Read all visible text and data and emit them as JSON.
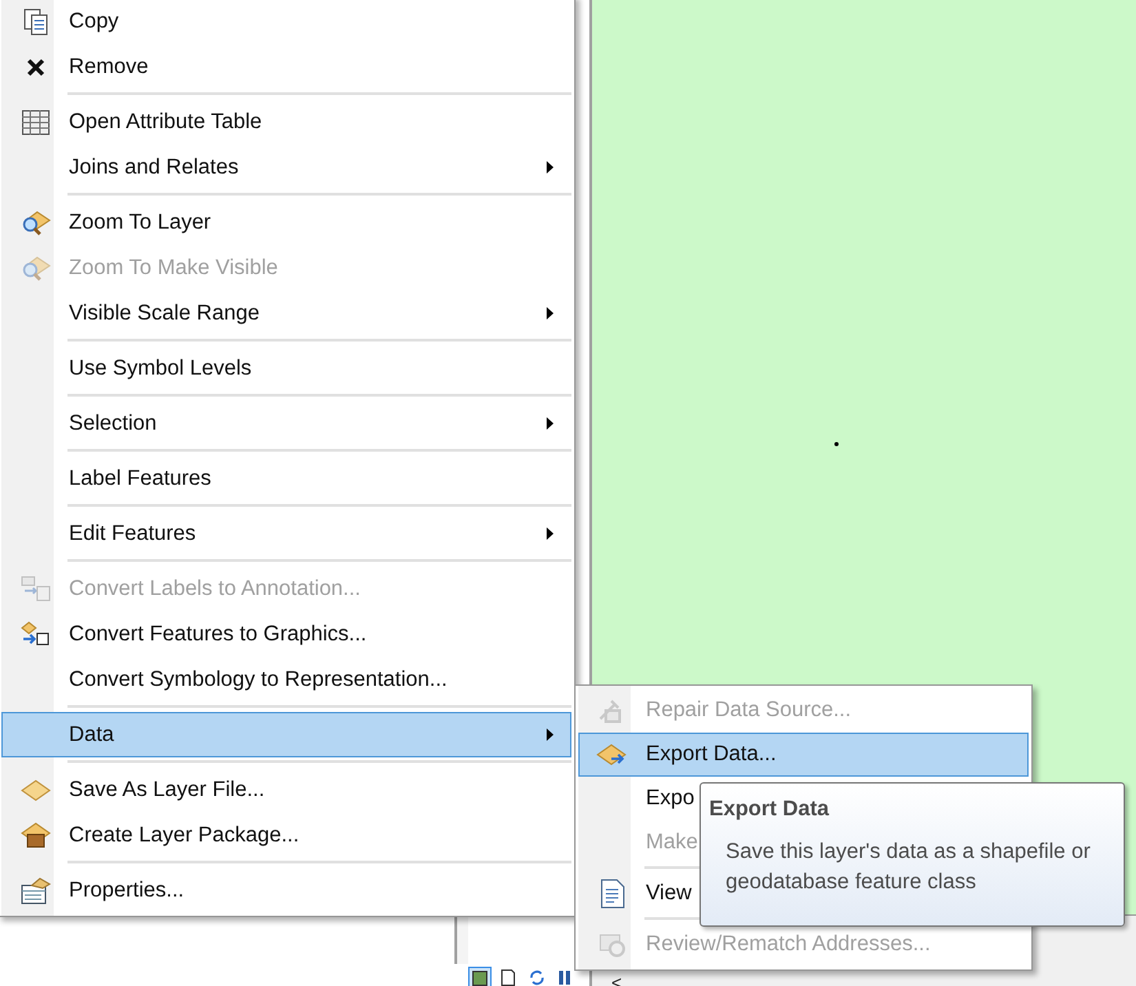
{
  "context_menu": {
    "items": [
      {
        "kind": "item",
        "label": "Copy",
        "disabled": false,
        "selected": false,
        "submenu": false
      },
      {
        "kind": "item",
        "label": "Remove",
        "disabled": false,
        "selected": false,
        "submenu": false
      },
      {
        "kind": "separator"
      },
      {
        "kind": "item",
        "label": "Open Attribute Table",
        "disabled": false,
        "selected": false,
        "submenu": false
      },
      {
        "kind": "item",
        "label": "Joins and Relates",
        "disabled": false,
        "selected": false,
        "submenu": true
      },
      {
        "kind": "separator"
      },
      {
        "kind": "item",
        "label": "Zoom To Layer",
        "disabled": false,
        "selected": false,
        "submenu": false
      },
      {
        "kind": "item",
        "label": "Zoom To Make Visible",
        "disabled": true,
        "selected": false,
        "submenu": false
      },
      {
        "kind": "item",
        "label": "Visible Scale Range",
        "disabled": false,
        "selected": false,
        "submenu": true
      },
      {
        "kind": "separator"
      },
      {
        "kind": "item",
        "label": "Use Symbol Levels",
        "disabled": false,
        "selected": false,
        "submenu": false
      },
      {
        "kind": "separator"
      },
      {
        "kind": "item",
        "label": "Selection",
        "disabled": false,
        "selected": false,
        "submenu": true
      },
      {
        "kind": "separator"
      },
      {
        "kind": "item",
        "label": "Label Features",
        "disabled": false,
        "selected": false,
        "submenu": false
      },
      {
        "kind": "separator"
      },
      {
        "kind": "item",
        "label": "Edit Features",
        "disabled": false,
        "selected": false,
        "submenu": true
      },
      {
        "kind": "separator"
      },
      {
        "kind": "item",
        "label": "Convert Labels to Annotation...",
        "disabled": true,
        "selected": false,
        "submenu": false
      },
      {
        "kind": "item",
        "label": "Convert Features to Graphics...",
        "disabled": false,
        "selected": false,
        "submenu": false
      },
      {
        "kind": "item",
        "label": "Convert Symbology to Representation...",
        "disabled": false,
        "selected": false,
        "submenu": false
      },
      {
        "kind": "separator"
      },
      {
        "kind": "item",
        "label": "Data",
        "disabled": false,
        "selected": true,
        "submenu": true
      },
      {
        "kind": "separator"
      },
      {
        "kind": "item",
        "label": "Save As Layer File...",
        "disabled": false,
        "selected": false,
        "submenu": false
      },
      {
        "kind": "item",
        "label": "Create Layer Package...",
        "disabled": false,
        "selected": false,
        "submenu": false
      },
      {
        "kind": "separator"
      },
      {
        "kind": "item",
        "label": "Properties...",
        "disabled": false,
        "selected": false,
        "submenu": false
      }
    ]
  },
  "data_submenu": {
    "items": [
      {
        "kind": "item",
        "label": "Repair Data Source...",
        "disabled": true,
        "selected": false
      },
      {
        "kind": "item",
        "label": "Export Data...",
        "disabled": false,
        "selected": true
      },
      {
        "kind": "item",
        "label": "Expo",
        "disabled": false,
        "selected": false
      },
      {
        "kind": "item",
        "label": "Make",
        "disabled": true,
        "selected": false
      },
      {
        "kind": "separator"
      },
      {
        "kind": "item",
        "label": "View",
        "disabled": false,
        "selected": false
      },
      {
        "kind": "separator"
      },
      {
        "kind": "item",
        "label": "Review/Rematch Addresses...",
        "disabled": true,
        "selected": false
      }
    ]
  },
  "tooltip": {
    "title": "Export Data",
    "text": "Save this layer's data as a shapefile or geodatabase feature class"
  },
  "toc_toolbar": {
    "collapse_label": "<"
  }
}
